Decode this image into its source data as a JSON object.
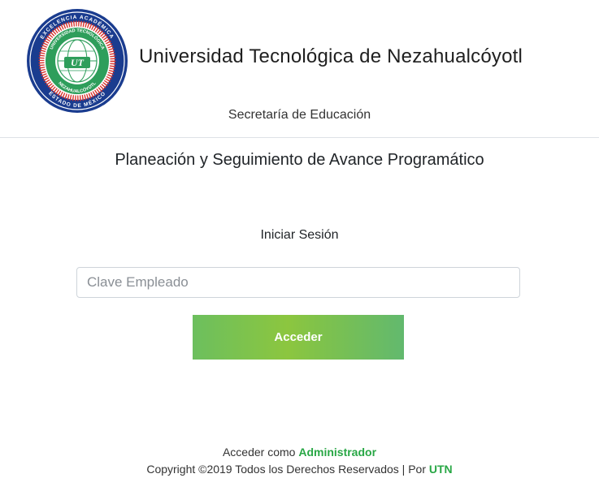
{
  "header": {
    "university_name": "Universidad Tecnológica de Nezahualcóyotl",
    "secretaria": "Secretaría de Educación",
    "logo": {
      "outer_text_top": "EXCELENCIA ACADÉMICA",
      "outer_text_bottom": "ESTADO DE MÉXICO",
      "inner_text_top": "UNIVERSIDAD TECNOLÓGICA",
      "inner_text_bottom": "NEZAHUALCÓYOTL",
      "monogram": "UT"
    }
  },
  "main": {
    "system_title": "Planeación y Seguimiento de Avance Programático",
    "login_heading": "Iniciar Sesión",
    "employee_field": {
      "placeholder": "Clave Empleado",
      "value": ""
    },
    "submit_label": "Acceder"
  },
  "footer": {
    "admin_prefix": "Acceder como ",
    "admin_link": "Administrador",
    "copyright_prefix": "Copyright ©2019 Todos los Derechos Reservados | Por ",
    "copyright_link": "UTN"
  },
  "colors": {
    "accent_green": "#28a745",
    "button_gradient_start": "#6cbf5e",
    "button_gradient_mid": "#8cc63f",
    "button_gradient_end": "#62b96e",
    "logo_blue": "#1a3c8f",
    "logo_red": "#d9312b",
    "logo_green": "#2e9e5b"
  }
}
